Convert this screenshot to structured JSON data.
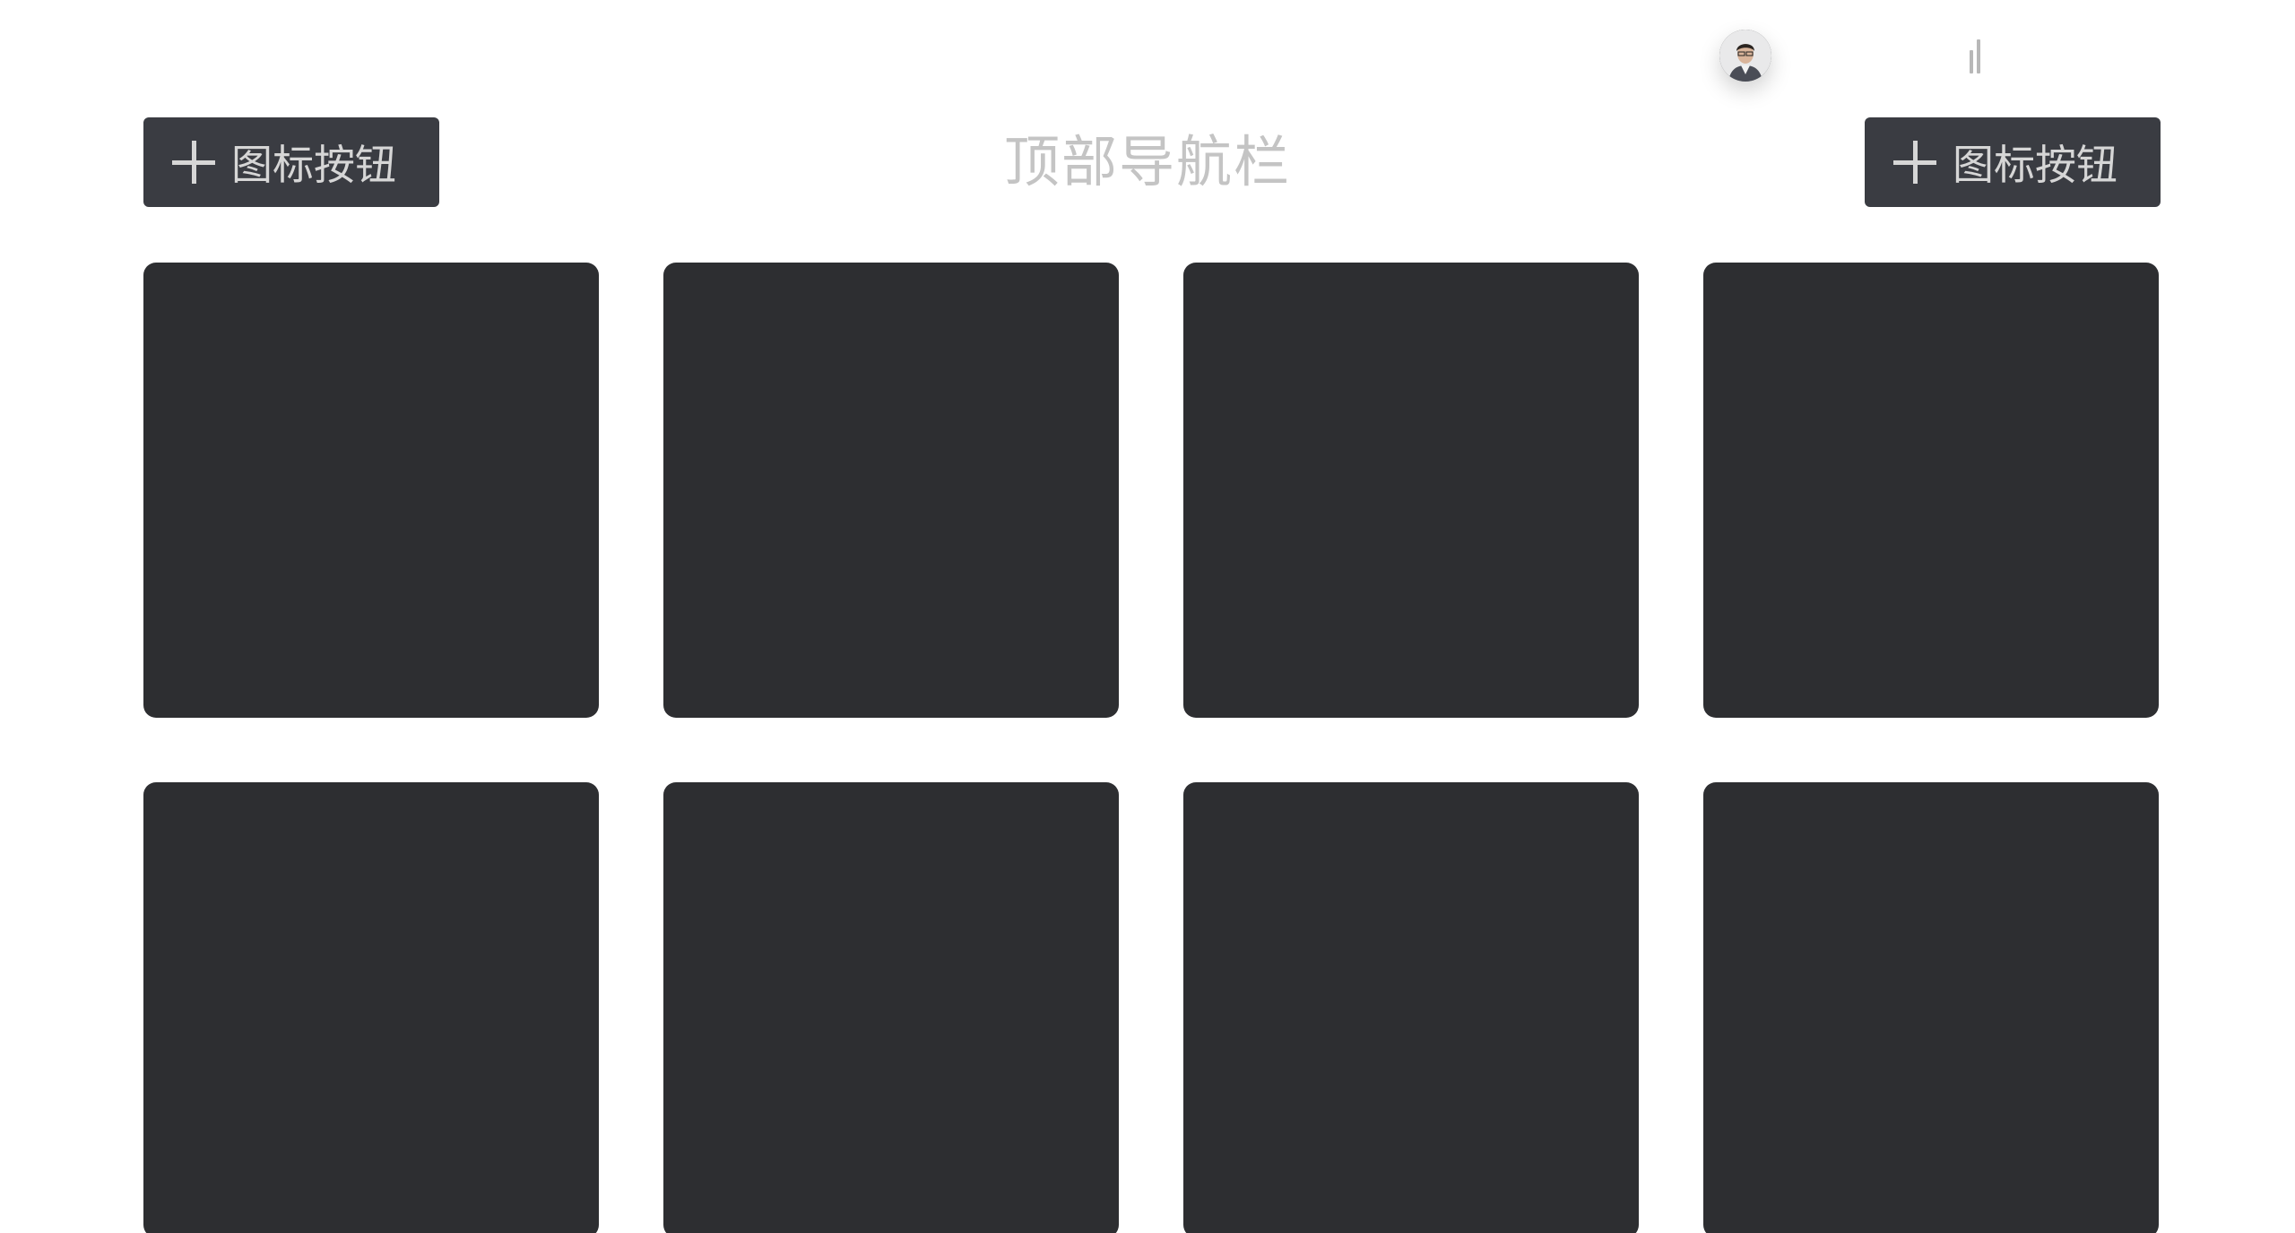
{
  "status_bar": {
    "avatar_icon": "user-avatar",
    "signal_icon": "signal-bars-icon"
  },
  "header": {
    "title": "顶部导航栏",
    "left_button": {
      "label": "图标按钮",
      "icon": "plus-icon"
    },
    "right_button": {
      "label": "图标按钮",
      "icon": "plus-icon"
    }
  },
  "tiles": [
    {
      "row": 1,
      "col": 1
    },
    {
      "row": 1,
      "col": 2
    },
    {
      "row": 1,
      "col": 3
    },
    {
      "row": 1,
      "col": 4
    },
    {
      "row": 2,
      "col": 1
    },
    {
      "row": 2,
      "col": 2
    },
    {
      "row": 2,
      "col": 3
    },
    {
      "row": 2,
      "col": 4
    }
  ],
  "colors": {
    "background": "#ffffff",
    "button_bg": "#3a3c42",
    "tile_bg": "#2d2e31",
    "title_text": "#c4c4c4"
  }
}
